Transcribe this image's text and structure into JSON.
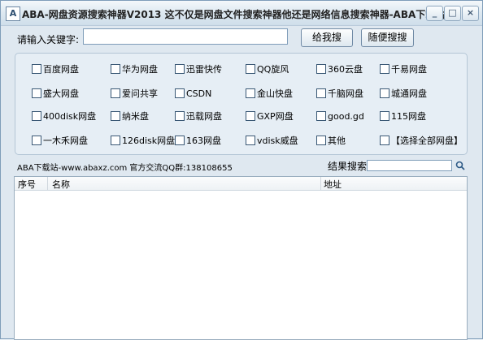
{
  "window": {
    "title": "ABA-网盘资源搜索神器V2013 这不仅是网盘文件搜索神器他还是网络信息搜索神器-ABA下载站",
    "icon_letter": "A",
    "controls": {
      "minimize": "_",
      "maximize": "□",
      "close": "×"
    }
  },
  "search": {
    "label": "请输入关键字:",
    "value": "",
    "search_button": "给我搜",
    "random_button": "随便搜搜"
  },
  "netdisks": {
    "rows": [
      [
        "百度网盘",
        "华为网盘",
        "迅雷快传",
        "QQ旋风",
        "360云盘",
        "千易网盘"
      ],
      [
        "盛大网盘",
        "爱问共享",
        "CSDN",
        "金山快盘",
        "千脑网盘",
        "城通网盘"
      ],
      [
        "400disk网盘",
        "纳米盘",
        "迅载网盘",
        "GXP网盘",
        "good.gd",
        "115网盘"
      ],
      [
        "一木禾网盘",
        "126disk网盘",
        "163网盘",
        "vdisk威盘",
        "其他",
        "【选择全部网盘】"
      ]
    ],
    "checked": false
  },
  "status": {
    "site_text": "ABA下载站-www.abaxz.com 官方交流QQ群:138108655"
  },
  "results": {
    "search_label": "结果搜索:",
    "search_value": "",
    "icon": "magnifier-icon",
    "columns": [
      "序号",
      "名称",
      "地址"
    ],
    "rows": []
  },
  "colors": {
    "window_bg": "#dfe8f0",
    "border": "#7f9db9",
    "group_bg": "#e6eef5"
  }
}
